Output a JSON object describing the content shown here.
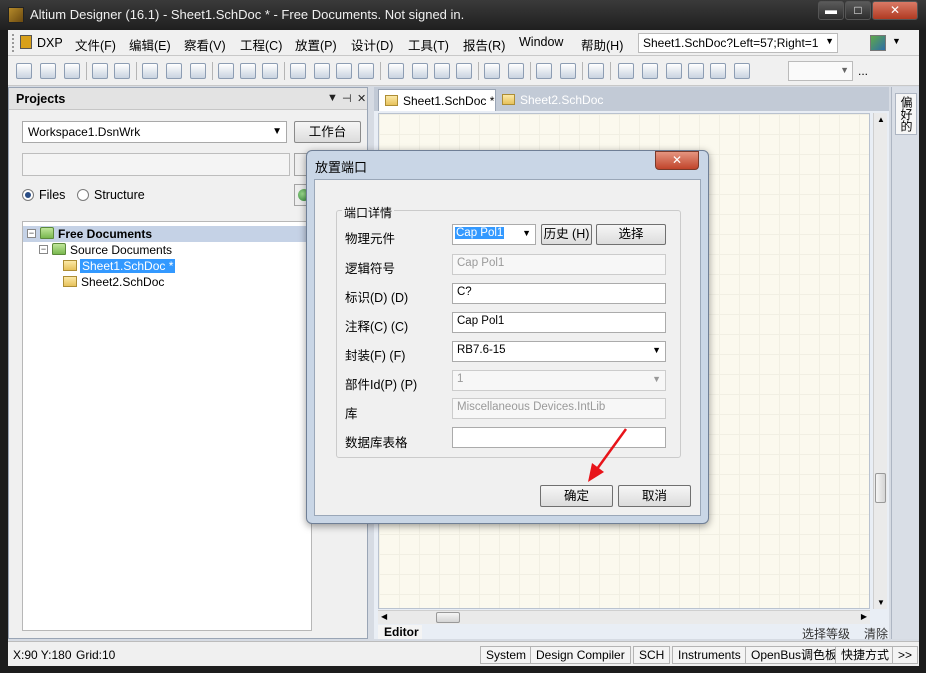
{
  "window": {
    "title": "Altium Designer (16.1) - Sheet1.SchDoc * - Free Documents. Not signed in.",
    "min_glyph": "▬",
    "max_glyph": "□",
    "close_glyph": "✕"
  },
  "menubar": {
    "items": [
      "DXP",
      "文件(F)",
      "编辑(E)",
      "察看(V)",
      "工程(C)",
      "放置(P)",
      "设计(D)",
      "工具(T)",
      "报告(R)",
      "Window",
      "帮助(H)"
    ],
    "document_combo": "Sheet1.SchDoc?Left=57;Right=1"
  },
  "toolbar": {
    "more_label": "..."
  },
  "projects_panel": {
    "title": "Projects",
    "controls": [
      "▼",
      "⊣",
      "✕"
    ],
    "workspace": "Workspace1.DsnWrk",
    "workspace_button": "工作台",
    "search_value": "",
    "view_options": [
      "Files",
      "Structure"
    ],
    "selected_view": "Files",
    "tree": [
      {
        "label": "Free Documents",
        "level": 0,
        "expander": "−"
      },
      {
        "label": "Source Documents",
        "level": 1,
        "expander": "−"
      },
      {
        "label": "Sheet1.SchDoc *",
        "level": 2,
        "selected": true
      },
      {
        "label": "Sheet2.SchDoc",
        "level": 2
      }
    ]
  },
  "editor": {
    "tabs": [
      {
        "label": "Sheet1.SchDoc *",
        "active": true
      },
      {
        "label": "Sheet2.SchDoc",
        "active": false
      }
    ],
    "bottom_tab": "Editor",
    "filter_label": "选择等级",
    "clear_label": "清除"
  },
  "side_panel": {
    "tab": "偏好的"
  },
  "statusbar": {
    "coords": "X:90 Y:180",
    "grid": "Grid:10",
    "buttons": [
      "System",
      "Design Compiler",
      "SCH",
      "Instruments",
      "OpenBus调色板",
      "快捷方式",
      ">>"
    ]
  },
  "dialog": {
    "title": "放置端口",
    "group_title": "端口详情",
    "fields": {
      "physical_component": {
        "label": "物理元件",
        "value": "Cap Pol1"
      },
      "logical_symbol": {
        "label": "逻辑符号",
        "value": "Cap Pol1"
      },
      "designator": {
        "label": "标识(D) (D)",
        "value": "C?"
      },
      "comment": {
        "label": "注释(C) (C)",
        "value": "Cap Pol1"
      },
      "footprint": {
        "label": "封装(F) (F)",
        "value": "RB7.6-15"
      },
      "part_id": {
        "label": "部件Id(P) (P)",
        "value": "1"
      },
      "library": {
        "label": "库",
        "value": "Miscellaneous Devices.IntLib"
      },
      "database_table": {
        "label": "数据库表格",
        "value": ""
      }
    },
    "history_button": "历史 (H)",
    "choose_button": "选择",
    "ok_button": "确定",
    "cancel_button": "取消"
  },
  "colors": {
    "annotation_arrow": "#e8141a",
    "selection_blue": "#3399ff"
  }
}
